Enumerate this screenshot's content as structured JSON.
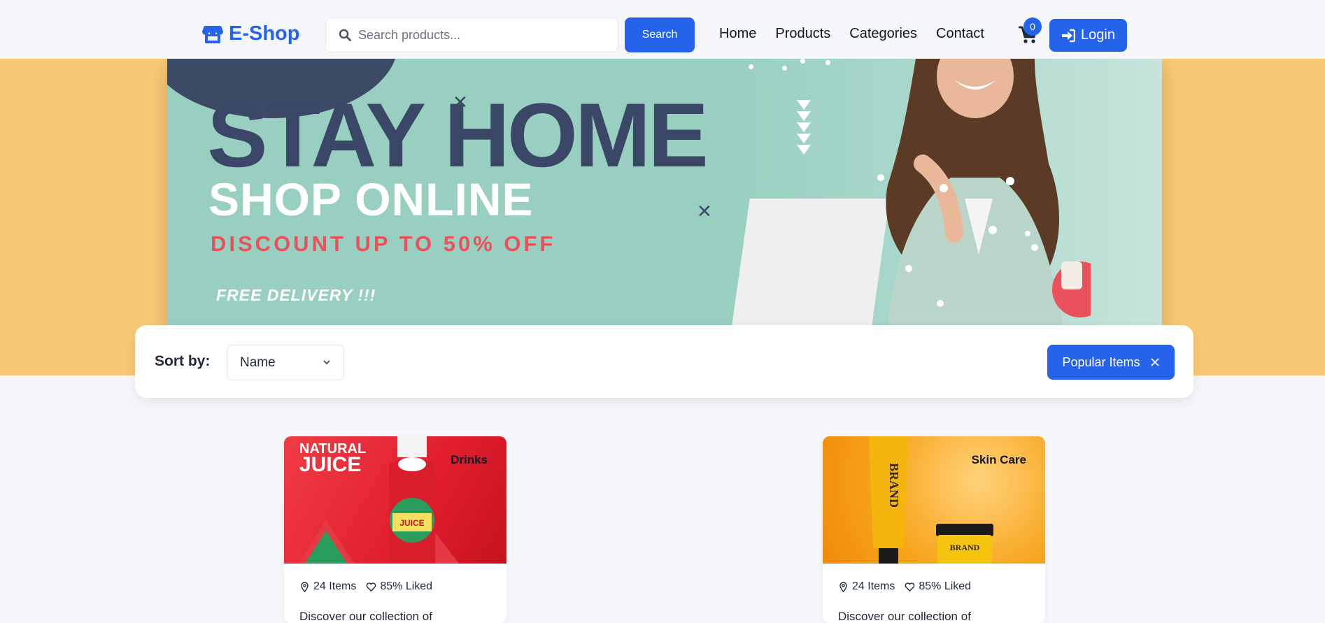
{
  "brand": {
    "name": "E-Shop",
    "icon": "store-icon",
    "color": "#2563eb"
  },
  "search": {
    "placeholder": "Search products...",
    "button_label": "Search"
  },
  "nav": {
    "links": [
      "Home",
      "Products",
      "Categories",
      "Contact"
    ]
  },
  "cart": {
    "count": "0",
    "icon": "cart-icon"
  },
  "login": {
    "label": "Login",
    "icon": "sign-in-icon"
  },
  "banner": {
    "headline": "STAY HOME",
    "subheadline": "SHOP ONLINE",
    "discount": "DISCOUNT UP TO 50% OFF",
    "delivery": "FREE DELIVERY !!!"
  },
  "sort": {
    "label": "Sort by:",
    "selected": "Name"
  },
  "filter_chip": {
    "label": "Popular Items"
  },
  "cards": [
    {
      "category": "Drinks",
      "image_label": "NATURAL JUICE",
      "items": "24 Items",
      "liked": "85% Liked",
      "description": "Discover our collection of"
    },
    {
      "category": "Skin Care",
      "image_label": "BRAND",
      "items": "24 Items",
      "liked": "85% Liked",
      "description": "Discover our collection of"
    }
  ],
  "colors": {
    "accent": "#2563eb",
    "hero_background": "#f8c872",
    "banner_teal": "#99cfc0",
    "headline_navy": "#3a4766",
    "discount_red": "#e9525a"
  }
}
